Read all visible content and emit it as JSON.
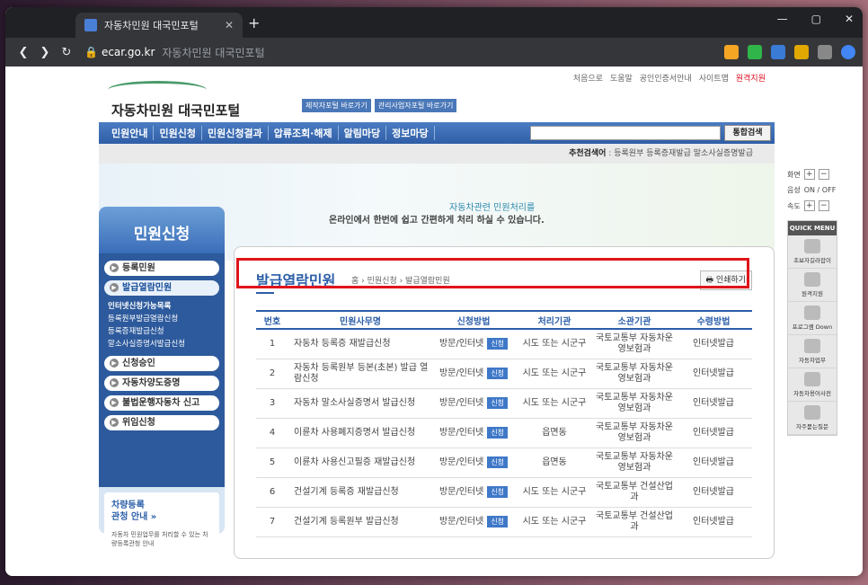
{
  "browser": {
    "tab_title": "자동차민원 대국민포털",
    "tab_close": "✕",
    "new_tab": "+",
    "domain": "ecar.go.kr",
    "page_title": "자동차민원 대국민포털"
  },
  "toplinks": [
    "처음으로",
    "도움말",
    "공인인증서안내",
    "사이트맵",
    "원격지원"
  ],
  "logo_text": "자동차민원 대국민포털",
  "top_buttons": [
    "제작자포털 바로가기",
    "관리사업자포털 바로가기"
  ],
  "gnb": [
    "민원안내",
    "민원신청",
    "민원신청결과",
    "압류조회·해제",
    "알림마당",
    "정보마당"
  ],
  "search": {
    "button": "통합검색",
    "placeholder": ""
  },
  "recommend": {
    "label": "추천검색어",
    "items": "등록원부  등록증재발급  말소사실증명발급"
  },
  "banner": {
    "line1": "자동차관련 민원처리를",
    "line2": "온라인에서 한번에 쉽고 간편하게 처리 하실 수 있습니다."
  },
  "sidebar": {
    "title": "민원신청",
    "menu": [
      "등록민원",
      "발급열람민원",
      "신청승인",
      "자동차양도증명",
      "불법운행자동차 신고",
      "위임신청"
    ],
    "submenu": [
      "인터넷신청가능목록",
      "등록원부발급열람신청",
      "등록증재발급신청",
      "말소사실증명서발급신청"
    ],
    "promo_title1": "차량등록",
    "promo_title2": "관청 안내 »",
    "promo_desc": "자동차 민원업무를 처리할 수 있는 차량등록관청 안내"
  },
  "content": {
    "title": "발급열람민원",
    "breadcrumb": "홈 › 민원신청 › 발급열람민원",
    "print": "인쇄하기",
    "columns": [
      "번호",
      "민원사무명",
      "신청방법",
      "처리기관",
      "소관기관",
      "수령방법"
    ],
    "badge": "신청",
    "rows": [
      [
        "1",
        "자동차 등록증 재발급신청",
        "방문/인터넷",
        "시도 또는 시군구",
        "국토교통부 자동차운영보험과",
        "인터넷발급"
      ],
      [
        "2",
        "자동차 등록원부 등본(초본) 발급 열람신청",
        "방문/인터넷",
        "시도 또는 시군구",
        "국토교통부 자동차운영보험과",
        "인터넷발급"
      ],
      [
        "3",
        "자동차 말소사실증명서 발급신청",
        "방문/인터넷",
        "시도 또는 시군구",
        "국토교통부 자동차운영보험과",
        "인터넷발급"
      ],
      [
        "4",
        "이륜차 사용폐지증명서 발급신청",
        "방문/인터넷",
        "읍면동",
        "국토교통부 자동차운영보험과",
        "인터넷발급"
      ],
      [
        "5",
        "이륜차 사용신고필증 재발급신청",
        "방문/인터넷",
        "읍면동",
        "국토교통부 자동차운영보험과",
        "인터넷발급"
      ],
      [
        "6",
        "건설기계 등록증 재발급신청",
        "방문/인터넷",
        "시도 또는 시군구",
        "국토교통부 건설산업과",
        "인터넷발급"
      ],
      [
        "7",
        "건설기계 등록원부 발급신청",
        "방문/인터넷",
        "시도 또는 시군구",
        "국토교통부 건설산업과",
        "인터넷발급"
      ]
    ]
  },
  "quick": {
    "screen": "화면",
    "voice": "음성",
    "voice_state": "ON / OFF",
    "speed": "속도",
    "menu_title": "QUICK MENU",
    "items": [
      "초보자길라잡이",
      "원격지원",
      "프로그램 Down",
      "자동차업무",
      "자동차용어사전",
      "자주묻는질문"
    ]
  }
}
